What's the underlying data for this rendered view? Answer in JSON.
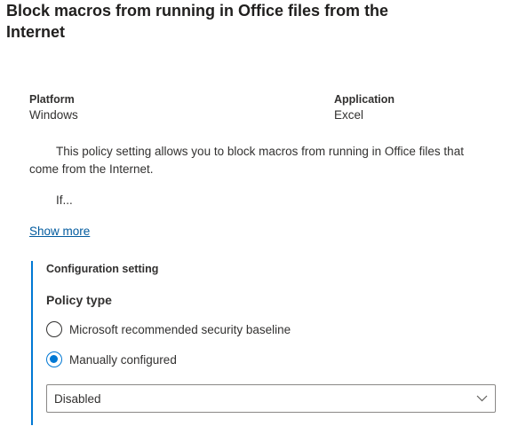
{
  "policy": {
    "title": "Block macros from running in Office files from the Internet"
  },
  "meta": {
    "platform_label": "Platform",
    "platform_value": "Windows",
    "application_label": "Application",
    "application_value": "Excel"
  },
  "description": {
    "text": "This policy setting allows you to block macros from running in Office files that come from the Internet.",
    "truncated": "If...",
    "show_more": "Show more"
  },
  "config": {
    "heading": "Configuration setting",
    "policy_type_label": "Policy type",
    "options": [
      {
        "label": "Microsoft recommended security baseline",
        "selected": false
      },
      {
        "label": "Manually configured",
        "selected": true
      }
    ],
    "dropdown_value": "Disabled"
  },
  "colors": {
    "accent": "#0078d4",
    "link": "#005a9e",
    "text": "#323130"
  }
}
